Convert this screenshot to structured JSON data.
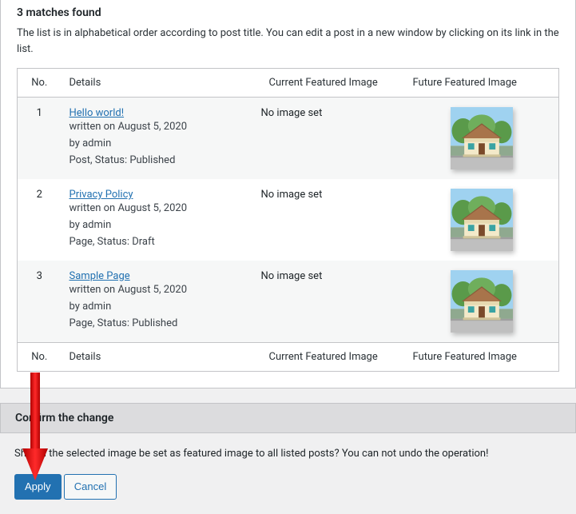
{
  "header": {
    "matches_title": "3 matches found",
    "description": "The list is in alphabetical order according to post title. You can edit a post in a new window by clicking on its link in the list."
  },
  "columns": {
    "no": "No.",
    "details": "Details",
    "current": "Current Featured Image",
    "future": "Future Featured Image"
  },
  "rows": [
    {
      "no": "1",
      "title": "Hello world!",
      "written": "written on August 5, 2020",
      "by": "by admin",
      "type_status": "Post, Status: Published",
      "current": "No image set"
    },
    {
      "no": "2",
      "title": "Privacy Policy",
      "written": "written on August 5, 2020",
      "by": "by admin",
      "type_status": "Page, Status: Draft",
      "current": "No image set"
    },
    {
      "no": "3",
      "title": "Sample Page",
      "written": "written on August 5, 2020",
      "by": "by admin",
      "type_status": "Page, Status: Published",
      "current": "No image set"
    }
  ],
  "confirm": {
    "heading": "Confirm the change",
    "text": "Should the selected image be set as featured image to all listed posts? You can not undo the operation!",
    "apply": "Apply",
    "cancel": "Cancel"
  }
}
